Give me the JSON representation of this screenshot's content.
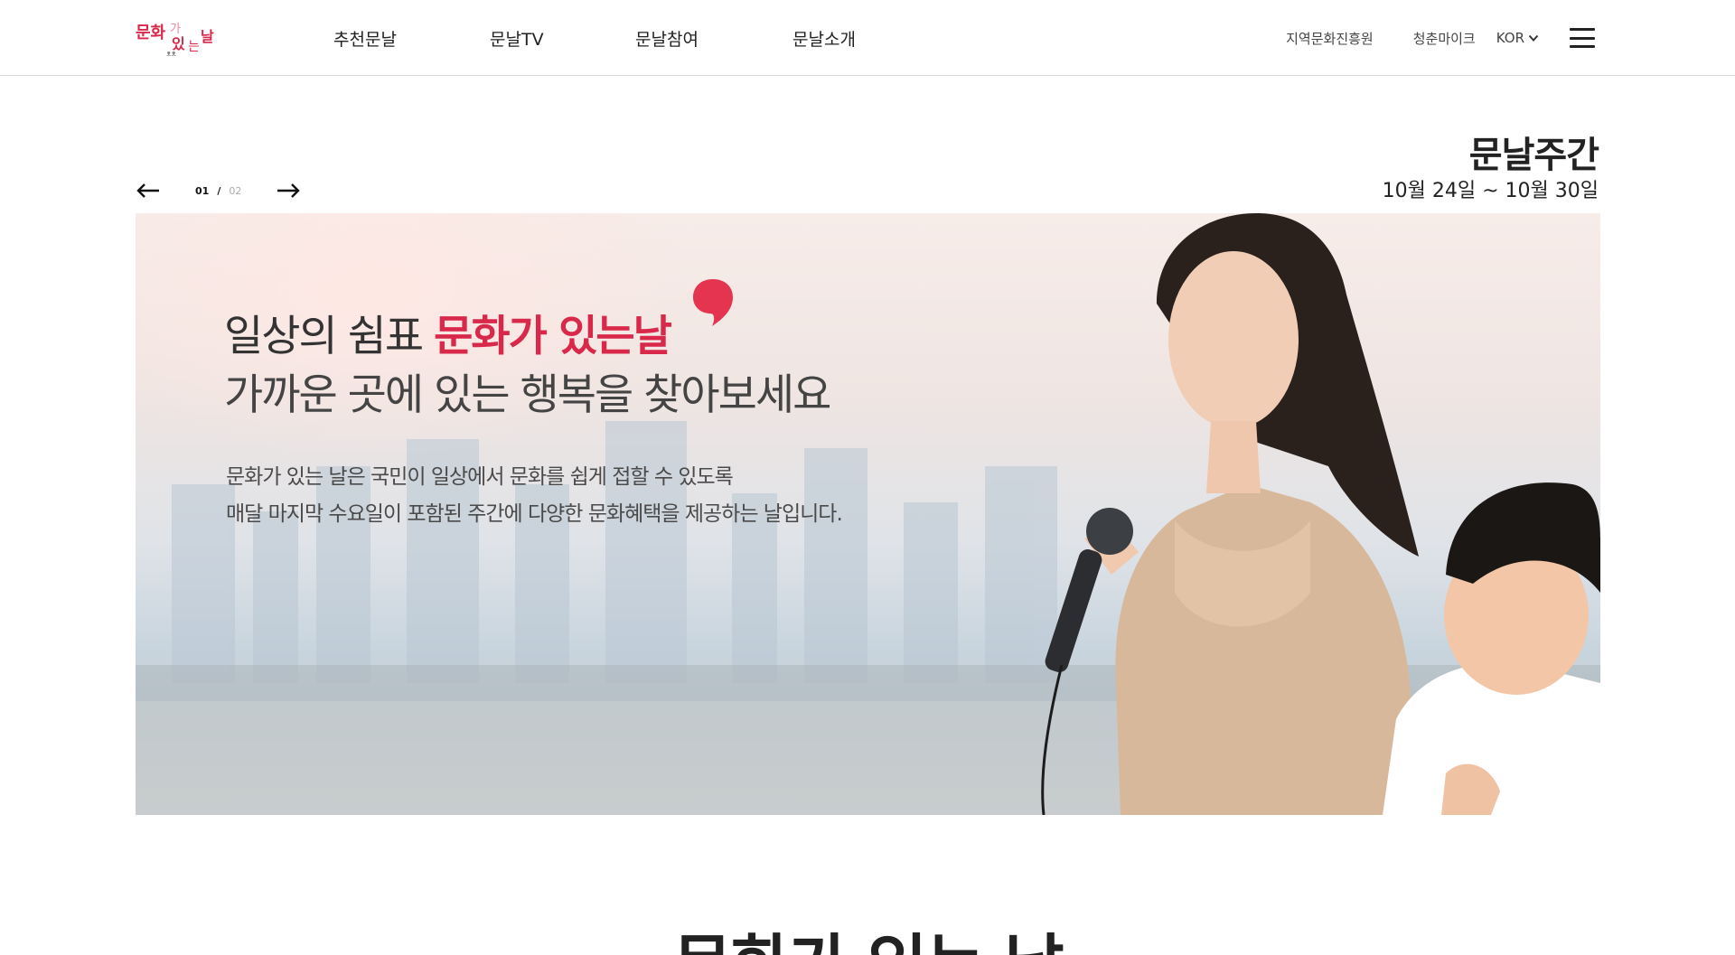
{
  "header": {
    "logo_text": "문화가 있는 날",
    "nav": [
      "추천문날",
      "문날TV",
      "문날참여",
      "문날소개"
    ],
    "util_links": [
      "지역문화진흥원",
      "청춘마이크"
    ],
    "language": "KOR",
    "icons": {
      "menu": "hamburger-menu-icon",
      "lang": "chevron-down-icon"
    }
  },
  "slider": {
    "current": "01",
    "separator": "/",
    "total": "02",
    "icons": {
      "prev": "arrow-left-icon",
      "next": "arrow-right-icon"
    }
  },
  "week": {
    "title": "문날주간",
    "date": "10월 24일 ~ 10월 30일"
  },
  "banner": {
    "headline_prefix": "일상의 쉼표 ",
    "headline_highlight": "문화가 있는날",
    "headline2": "가까운 곳에 있는 행복을 찾아보세요",
    "desc_line1": "문화가 있는 날은 국민이 일상에서 문화를 쉽게 접할 수 있도록",
    "desc_line2": "매달 마지막 수요일이 포함된 주간에 다양한 문화혜택을 제공하는 날입니다."
  },
  "section": {
    "title_partial": "문화가 있는 날"
  },
  "colors": {
    "accent": "#d9294a",
    "text": "#222222"
  }
}
